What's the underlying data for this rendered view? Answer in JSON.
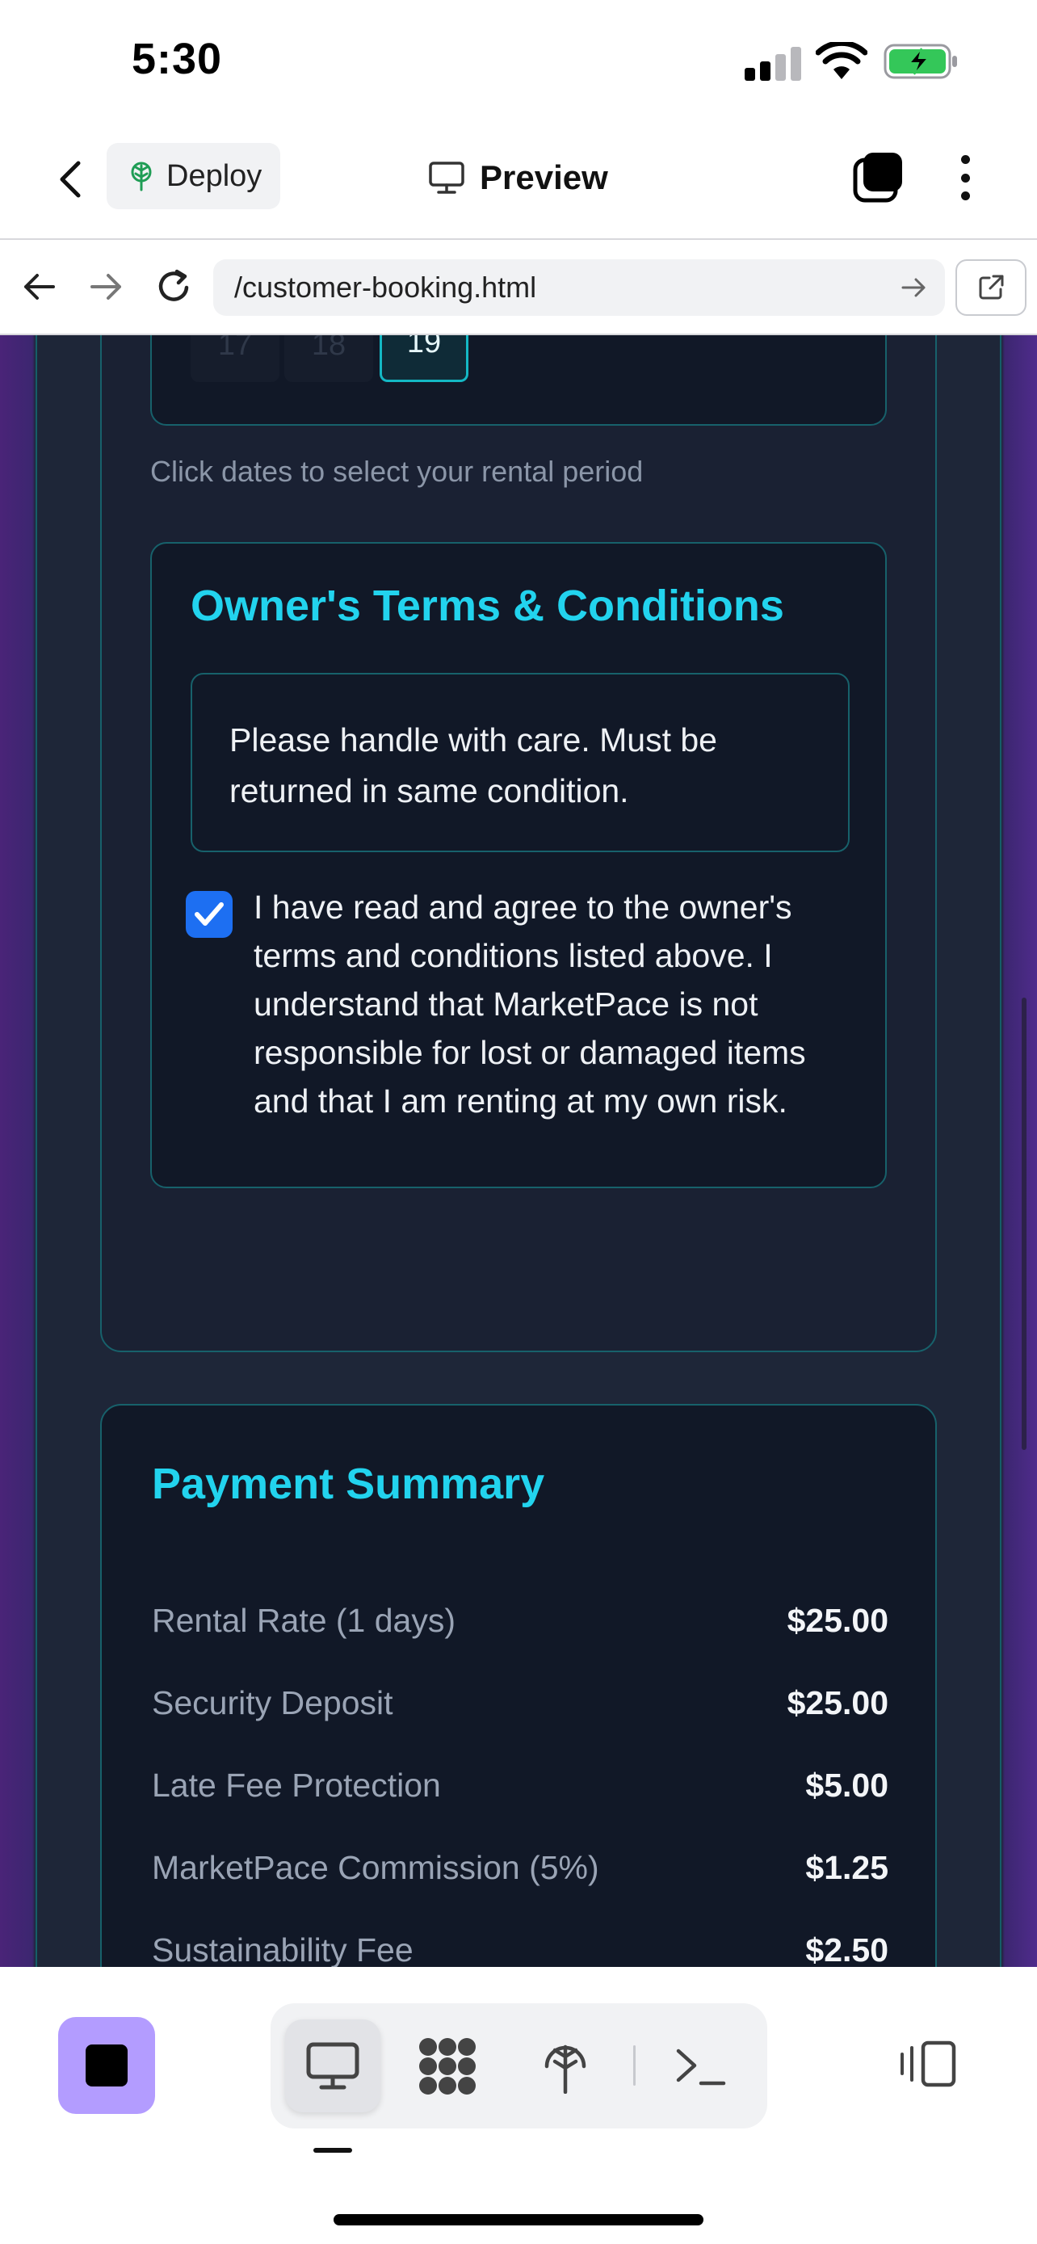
{
  "status_bar": {
    "time": "5:30"
  },
  "app_bar": {
    "deploy_label": "Deploy",
    "preview_label": "Preview"
  },
  "browser": {
    "url": "/customer-booking.html"
  },
  "calendar": {
    "visible_days": [
      "17",
      "18",
      "19"
    ],
    "selected_day": "19"
  },
  "hint": "Click dates to select your rental period",
  "terms": {
    "title": "Owner's Terms & Conditions",
    "text": "Please handle with care. Must be returned in same condition.",
    "agree_checked": true,
    "agree_text": "I have read and agree to the owner's terms and conditions listed above. I understand that MarketPace is not responsible for lost or damaged items and that I am renting at my own risk."
  },
  "payment": {
    "title": "Payment Summary",
    "rows": [
      {
        "label": "Rental Rate (1 days)",
        "amount": "$25.00"
      },
      {
        "label": "Security Deposit",
        "amount": "$25.00"
      },
      {
        "label": "Late Fee Protection",
        "amount": "$5.00"
      },
      {
        "label": "MarketPace Commission (5%)",
        "amount": "$1.25"
      },
      {
        "label": "Sustainability Fee",
        "amount": "$2.50"
      }
    ]
  },
  "colors": {
    "accent": "#22d3ee",
    "page_bg": "#1e2638",
    "card_bg": "#111827",
    "border": "#17616b",
    "checkbox": "#1d6ff2",
    "stop_button": "#b39cff"
  },
  "icons": {
    "status": [
      "signal-icon",
      "wifi-icon",
      "battery-charging-icon"
    ],
    "app_bar": [
      "back-chevron-icon",
      "deploy-icon",
      "monitor-icon",
      "tabs-icon",
      "more-vertical-icon"
    ],
    "url_bar": [
      "arrow-left-icon",
      "arrow-right-icon",
      "reload-icon",
      "go-arrow-icon",
      "open-external-icon"
    ],
    "toolbar": [
      "stop-icon",
      "monitor-icon",
      "apps-icon",
      "deploy-icon",
      "terminal-icon",
      "panel-toggle-icon"
    ]
  }
}
